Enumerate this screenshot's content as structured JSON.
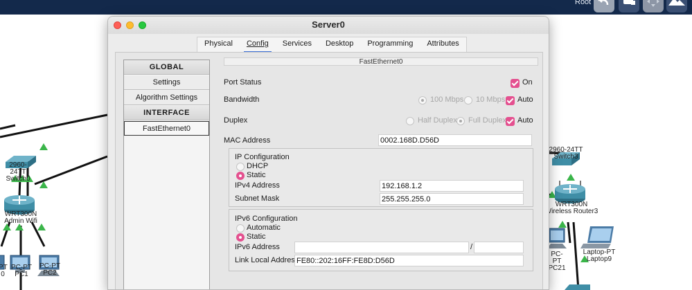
{
  "topbar": {
    "root_label": "Root"
  },
  "workspace": {
    "left_devices": [
      {
        "id": "switch0",
        "lines": [
          "2960-24TT",
          "Switch0"
        ]
      },
      {
        "id": "router",
        "lines": [
          "WRT300N",
          "Admin Wifi"
        ]
      },
      {
        "id": "pc-partial",
        "lines": [
          "PT",
          "0"
        ]
      },
      {
        "id": "pc1",
        "lines": [
          "PC-PT",
          "PC1"
        ]
      },
      {
        "id": "pc2",
        "lines": [
          "PC-PT",
          "PC2"
        ]
      }
    ],
    "right_devices": [
      {
        "id": "switch3",
        "lines": [
          "2960-24TT",
          "Switch3"
        ]
      },
      {
        "id": "router3",
        "lines": [
          "WRT300N",
          "Wireless Router3"
        ]
      },
      {
        "id": "pc21",
        "lines": [
          "PC-PT",
          "PC21"
        ]
      },
      {
        "id": "laptop9",
        "lines": [
          "Laptop-PT",
          "Laptop9"
        ]
      }
    ]
  },
  "window": {
    "title": "Server0",
    "tabs": [
      {
        "label": "Physical",
        "active": false
      },
      {
        "label": "Config",
        "active": true
      },
      {
        "label": "Services",
        "active": false
      },
      {
        "label": "Desktop",
        "active": false
      },
      {
        "label": "Programming",
        "active": false
      },
      {
        "label": "Attributes",
        "active": false
      }
    ]
  },
  "nav": {
    "global_header": "GLOBAL",
    "settings": "Settings",
    "algorithm_settings": "Algorithm Settings",
    "interface_header": "INTERFACE",
    "fastethernet0": "FastEthernet0"
  },
  "interface": {
    "title": "FastEthernet0",
    "port_status_label": "Port Status",
    "port_status_on_label": "On",
    "port_status_on": true,
    "bandwidth_label": "Bandwidth",
    "bandwidth_100": "100 Mbps",
    "bandwidth_10": "10 Mbps",
    "bandwidth_auto_label": "Auto",
    "bandwidth_auto": true,
    "duplex_label": "Duplex",
    "duplex_half": "Half Duplex",
    "duplex_full": "Full Duplex",
    "duplex_auto_label": "Auto",
    "duplex_auto": true,
    "mac_label": "MAC Address",
    "mac_value": "0002.168D.D56D",
    "ip_config": {
      "title": "IP Configuration",
      "dhcp": "DHCP",
      "static": "Static",
      "selected": "Static",
      "ipv4_label": "IPv4 Address",
      "ipv4_value": "192.168.1.2",
      "subnet_label": "Subnet Mask",
      "subnet_value": "255.255.255.0"
    },
    "ipv6_config": {
      "title": "IPv6 Configuration",
      "automatic": "Automatic",
      "static": "Static",
      "selected": "Static",
      "ipv6_label": "IPv6 Address",
      "ipv6_value": "",
      "prefix_sep": "/",
      "prefix_value": "",
      "link_local_label": "Link Local Address:",
      "link_local_value": "FE80::202:16FF:FE8D:D56D"
    }
  },
  "colors": {
    "topbar": "#13294b",
    "check_accent": "#e4508f",
    "link_green": "#3bb54a",
    "switch_teal": "#3f8ea6"
  }
}
